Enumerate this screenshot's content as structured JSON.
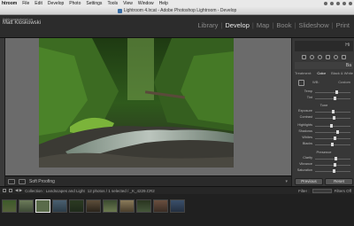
{
  "menubar": {
    "items": [
      "htroom",
      "File",
      "Edit",
      "Develop",
      "Photo",
      "Settings",
      "Tools",
      "View",
      "Window",
      "Help"
    ]
  },
  "window": {
    "title": "Lightroom 4.lrcat - Adobe Photoshop Lightroom - Develop"
  },
  "identity": {
    "line1": "lightroomtutorial.ca",
    "name": "Matt Kloskowski"
  },
  "modules": {
    "items": [
      {
        "label": "Library",
        "active": false
      },
      {
        "label": "Develop",
        "active": true
      },
      {
        "label": "Map",
        "active": false
      },
      {
        "label": "Book",
        "active": false
      },
      {
        "label": "Slideshow",
        "active": false
      },
      {
        "label": "Print",
        "active": false
      }
    ]
  },
  "toolbar": {
    "soft_proofing_label": "Soft Proofing"
  },
  "right_panel": {
    "histogram_label": "Hi",
    "basic_label": "Ba",
    "treatment": [
      "Treatment:",
      "Color",
      "Black & White"
    ],
    "wb_label": "WB:",
    "wb_value": "Custom",
    "temp_label": "Temp",
    "tint_label": "Tint",
    "tone_label": "Tone",
    "exposure_label": "Exposure",
    "contrast_label": "Contrast",
    "highlights_label": "Highlights",
    "shadows_label": "Shadows",
    "whites_label": "Whites",
    "blacks_label": "Blacks",
    "presence_label": "Presence",
    "clarity_label": "Clarity",
    "vibrance_label": "Vibrance",
    "saturation_label": "Saturation",
    "previous_label": "Previous",
    "reset_label": "Reset"
  },
  "filmstrip": {
    "collection_text": "Collection : Landscapes and Light",
    "count_text": "12 photos / 1 selected / _K_4229.CR2",
    "filter_label": "Filter :",
    "filter_value": "Filters Off"
  }
}
